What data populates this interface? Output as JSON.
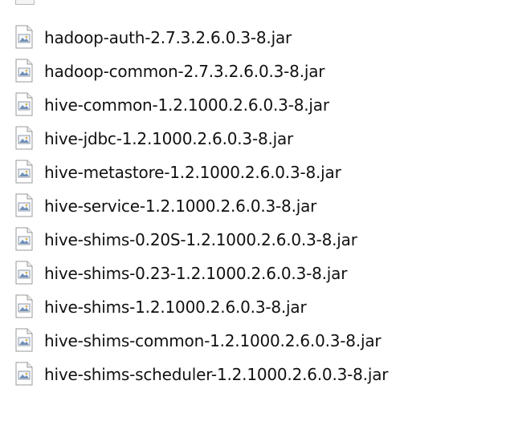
{
  "file_list": {
    "icon": "jar-file-icon",
    "files": [
      "hadoop-auth-2.7.3.2.6.0.3-8.jar",
      "hadoop-common-2.7.3.2.6.0.3-8.jar",
      "hive-common-1.2.1000.2.6.0.3-8.jar",
      "hive-jdbc-1.2.1000.2.6.0.3-8.jar",
      "hive-metastore-1.2.1000.2.6.0.3-8.jar",
      "hive-service-1.2.1000.2.6.0.3-8.jar",
      "hive-shims-0.20S-1.2.1000.2.6.0.3-8.jar",
      "hive-shims-0.23-1.2.1000.2.6.0.3-8.jar",
      "hive-shims-1.2.1000.2.6.0.3-8.jar",
      "hive-shims-common-1.2.1000.2.6.0.3-8.jar",
      "hive-shims-scheduler-1.2.1000.2.6.0.3-8.jar"
    ]
  }
}
